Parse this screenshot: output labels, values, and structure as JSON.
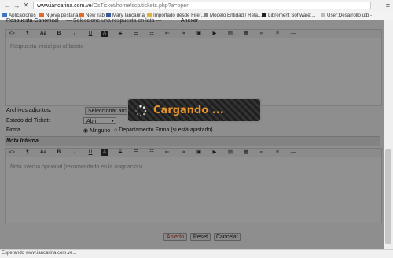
{
  "browser": {
    "url_host": "www.iancarina.com.ve",
    "url_path": "/OsTicket/home/scp/tickets.php?a=open",
    "bookmarks": [
      "Aplicaciones",
      "Nueva pestaña",
      "New Tab",
      "Mary Iancarina",
      "Importado desde Firef...",
      "Modelo Entidad / Rela...",
      "Librement Software:...",
      "User:Desarrollo utb -"
    ],
    "status_text": "Esperando www.iancarina.com.ve..."
  },
  "form": {
    "top_cut_label": "Respuesta Canonical",
    "top_cut_select": "— Seleccione una respuesta en lata —",
    "top_cut_check": "Anexar",
    "response_placeholder": "Respuesta inicial por al boleto",
    "attachments_label": "Archivos adjuntos:",
    "attachments_button": "Seleccionar archivos",
    "ticket_status_label": "Estado del Ticket:",
    "ticket_status_value": "Abrir",
    "signature_label": "Firma",
    "signature_none": "Ninguno",
    "signature_dept": "Departamento Firma (si está ajustado)",
    "internal_note_title": "Nota Interna",
    "internal_note_placeholder": "Nota interna opcional (recomendado en la asignación)",
    "btn_open": "Abierto",
    "btn_reset": "Reset",
    "btn_cancel": "Cancelar"
  },
  "loader": {
    "text": "Cargando ..."
  },
  "colors": {
    "loader_text": "#e8962a",
    "open_button_text": "#c0392b"
  }
}
